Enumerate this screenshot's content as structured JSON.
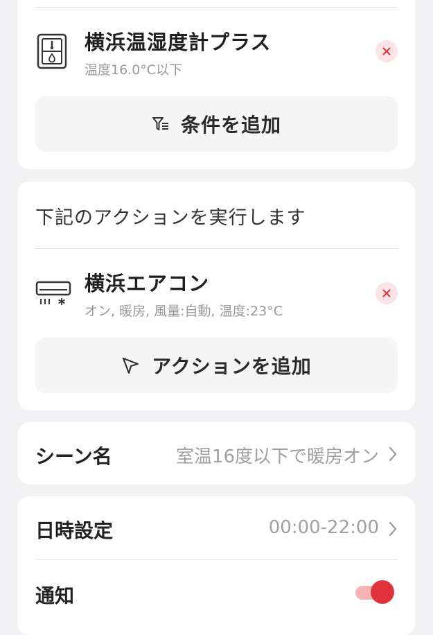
{
  "conditions": {
    "items": [
      {
        "icon": "thermo-hygrometer-icon",
        "title": "横浜温湿度計プラス",
        "subtitle": "温度16.0°C以下"
      }
    ],
    "add_label": "条件を追加"
  },
  "actions": {
    "header": "下記のアクションを実行します",
    "items": [
      {
        "icon": "air-conditioner-icon",
        "title": "横浜エアコン",
        "subtitle": "オン, 暖房, 風量:自動, 温度:23°C"
      }
    ],
    "add_label": "アクションを追加"
  },
  "scene": {
    "label": "シーン名",
    "value": "室温16度以下で暖房オン"
  },
  "schedule": {
    "label": "日時設定",
    "value": "00:00-22:00"
  },
  "notification": {
    "label": "通知",
    "enabled": true
  },
  "colors": {
    "accent": "#e0323c",
    "remove_bg": "#fbe4e6",
    "page_bg": "#f2f2f4"
  }
}
